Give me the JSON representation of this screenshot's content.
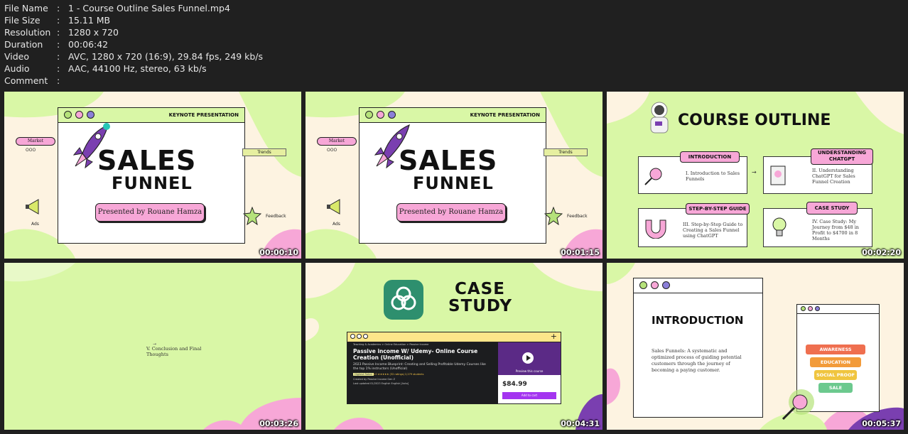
{
  "meta": [
    {
      "key": "File Name",
      "value": "1 - Course Outline Sales Funnel.mp4"
    },
    {
      "key": "File Size",
      "value": "15.11 MB"
    },
    {
      "key": "Resolution",
      "value": "1280 x 720"
    },
    {
      "key": "Duration",
      "value": "00:06:42"
    },
    {
      "key": "Video",
      "value": "AVC, 1280 x 720 (16:9), 29.84 fps, 249 kb/s"
    },
    {
      "key": "Audio",
      "value": "AAC, 44100 Hz, stereo, 63 kb/s"
    },
    {
      "key": "Comment",
      "value": ""
    }
  ],
  "sep": ":",
  "thumbs": [
    {
      "time": "00:00:10"
    },
    {
      "time": "00:01:15"
    },
    {
      "time": "00:02:20"
    },
    {
      "time": "00:03:26"
    },
    {
      "time": "00:04:31"
    },
    {
      "time": "00:05:37"
    }
  ],
  "title_slide": {
    "header": "KEYNOTE PRESENTATION",
    "title1": "SALES",
    "title2": "FUNNEL",
    "presenter": "Presented by Rouane Hamza",
    "market": "Market",
    "dots": "OOO",
    "trends": "Trends",
    "feedback": "Feedback",
    "ads": "Ads"
  },
  "outline_slide": {
    "title": "COURSE OUTLINE",
    "cards": [
      {
        "label": "INTRODUCTION",
        "text": "I. Introduction to Sales Funnels"
      },
      {
        "label": "UNDERSTANDING CHATGPT",
        "text": "II. Understanding ChatGPT for Sales Funnel Creation"
      },
      {
        "label": "STEP-BY-STEP GUIDE",
        "text": "III. Step-by-Step Guide to Creating a Sales Funnel using ChatGPT"
      },
      {
        "label": "CASE STUDY",
        "text": "IV. Case Study: My Journey from $48 in Profit to $4700 in 8 Months"
      }
    ]
  },
  "conclusion_slide": {
    "text": "V. Conclusion and Final Thoughts"
  },
  "case_slide": {
    "title1": "CASE",
    "title2": "STUDY",
    "breadcrumb": "Teaching & Academics  >  Online Education  >  Passive Income",
    "course_title": "Passive income W/ Udemy- Online Course Creation (Unofficial)",
    "subtitle": "2023 Passive Income Blueprint: Creating and Selling Profitable Udemy Courses like the top 1% instructors (Unofficial)",
    "badge": "Highest Rated",
    "rating": "5.0 ★★★★★ (32 ratings)  2,279 students",
    "created": "Created by Passive Income Gen Z",
    "updated": "Last updated 01/2023   English   English [Auto]",
    "preview": "Preview this course",
    "price": "$84.99",
    "cart": "Add to cart",
    "plus": "+"
  },
  "intro_slide": {
    "title": "INTRODUCTION",
    "text": "Sales Funnels: A systematic and optimized process of guiding potential customers through the journey of becoming a paying customer.",
    "funnel": [
      "AWARENESS",
      "EDUCATION",
      "SOCIAL PROOF",
      "SALE"
    ]
  },
  "colors": {
    "green": "#d9f7a6",
    "pink": "#f7a7d7",
    "cream": "#fdf3e1",
    "purple": "#7a3fb0"
  }
}
